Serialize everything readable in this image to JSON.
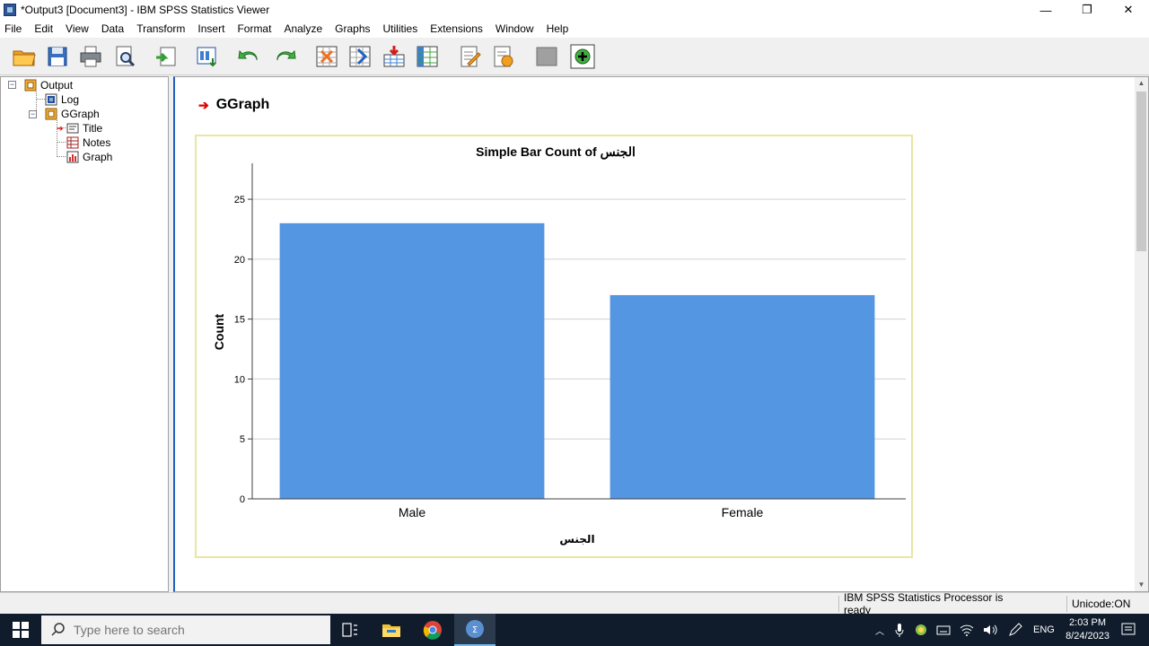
{
  "window": {
    "title": "*Output3 [Document3] - IBM SPSS Statistics Viewer",
    "minimize": "—",
    "restore": "❐",
    "close": "✕"
  },
  "menu": [
    {
      "label": "File"
    },
    {
      "label": "Edit"
    },
    {
      "label": "View"
    },
    {
      "label": "Data"
    },
    {
      "label": "Transform"
    },
    {
      "label": "Insert"
    },
    {
      "label": "Format"
    },
    {
      "label": "Analyze"
    },
    {
      "label": "Graphs"
    },
    {
      "label": "Utilities"
    },
    {
      "label": "Extensions"
    },
    {
      "label": "Window"
    },
    {
      "label": "Help"
    }
  ],
  "tree": {
    "root": "Output",
    "log": "Log",
    "ggraph": "GGraph",
    "title": "Title",
    "notes": "Notes",
    "graph": "Graph"
  },
  "content": {
    "section_title": "GGraph"
  },
  "chart_data": {
    "type": "bar",
    "title": "Simple Bar Count of الجنس",
    "xlabel": "الجنس",
    "ylabel": "Count",
    "categories": [
      "Male",
      "Female"
    ],
    "values": [
      23,
      17
    ],
    "ylim": [
      0,
      28
    ],
    "yticks": [
      0,
      5,
      10,
      15,
      20,
      25
    ],
    "bar_color": "#5596e2",
    "grid": true
  },
  "status": {
    "processor": "IBM SPSS Statistics Processor is ready",
    "unicode": "Unicode:ON"
  },
  "taskbar": {
    "search_placeholder": "Type here to search",
    "lang": "ENG",
    "time": "2:03 PM",
    "date": "8/24/2023"
  },
  "colors": {
    "accent": "#2060c0",
    "chart_frame": "#e8e6a0",
    "taskbar": "#101c2c"
  }
}
